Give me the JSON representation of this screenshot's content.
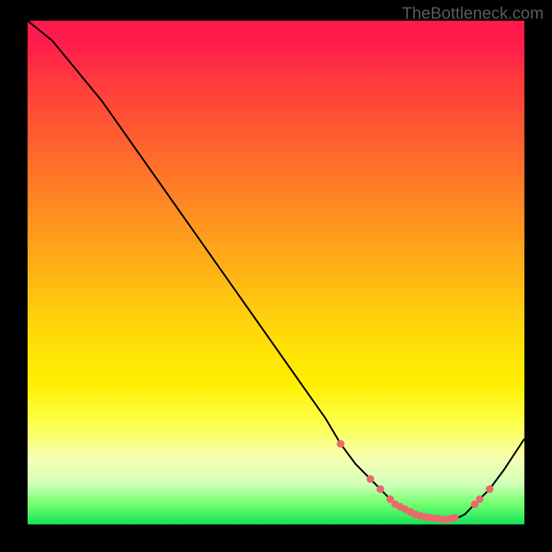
{
  "watermark": "TheBottleneck.com",
  "chart_data": {
    "type": "line",
    "title": "",
    "xlabel": "",
    "ylabel": "",
    "xlim": [
      0,
      100
    ],
    "ylim": [
      0,
      100
    ],
    "series": [
      {
        "name": "bottleneck-curve",
        "x": [
          0,
          5,
          10,
          15,
          20,
          25,
          30,
          35,
          40,
          45,
          50,
          55,
          60,
          63,
          66,
          69,
          72,
          74,
          76,
          78,
          80,
          82,
          84,
          86,
          88,
          90,
          93,
          96,
          100
        ],
        "y": [
          100,
          96,
          90,
          84,
          77,
          70,
          63,
          56,
          49,
          42,
          35,
          28,
          21,
          16,
          12,
          9,
          6,
          4,
          3,
          2,
          1,
          1,
          1,
          1,
          2,
          4,
          7,
          11,
          17
        ]
      }
    ],
    "markers": {
      "name": "highlight-dots",
      "color": "#e96a6a",
      "x": [
        63,
        69,
        71,
        73,
        74,
        75,
        76,
        77,
        78,
        79,
        80,
        81,
        82,
        83,
        84,
        85,
        86,
        90,
        91,
        93
      ],
      "y": [
        16,
        9,
        7,
        5,
        4,
        3.5,
        3,
        2.5,
        2,
        1.7,
        1.5,
        1.3,
        1.2,
        1.1,
        1,
        1.1,
        1.3,
        4,
        5,
        7
      ]
    },
    "gradient_stops": [
      {
        "pos": 0.0,
        "color": "#ff1a4c"
      },
      {
        "pos": 0.3,
        "color": "#ff7a28"
      },
      {
        "pos": 0.62,
        "color": "#ffda0a"
      },
      {
        "pos": 0.87,
        "color": "#f6ffb4"
      },
      {
        "pos": 1.0,
        "color": "#16e158"
      }
    ]
  }
}
